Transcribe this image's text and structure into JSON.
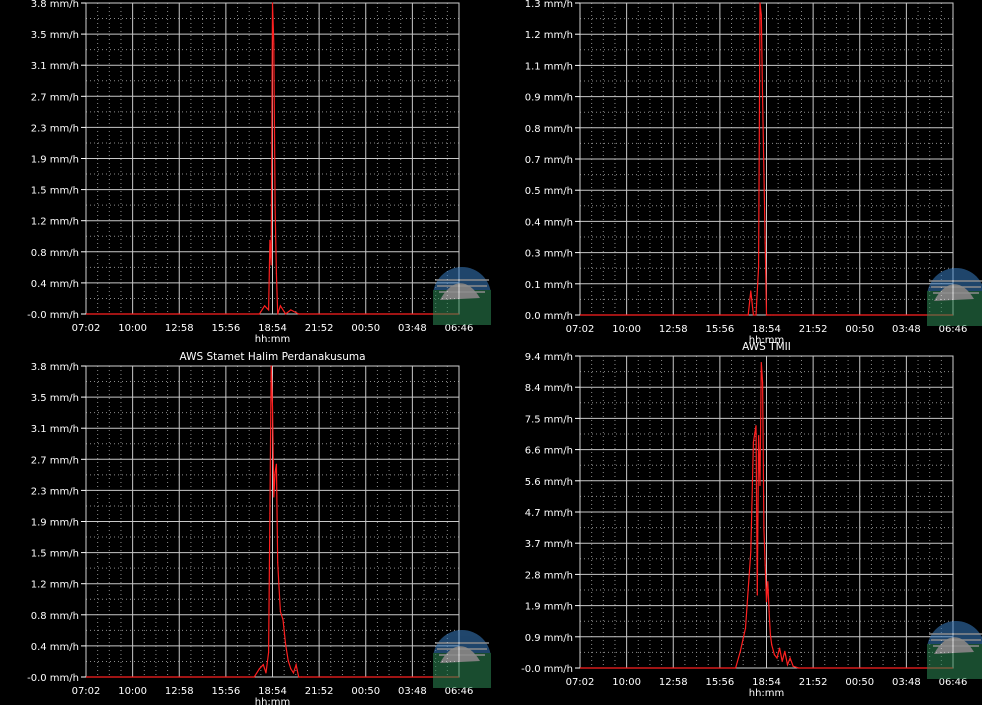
{
  "chart_data": [
    {
      "type": "line",
      "title": "",
      "xlabel": "hh:mm",
      "ylabel": "",
      "ylim": [
        0,
        3.8
      ],
      "grid": true,
      "x_ticks": [
        "07:02",
        "10:00",
        "12:58",
        "15:56",
        "18:54",
        "21:52",
        "00:50",
        "03:48",
        "06:46"
      ],
      "y_ticks": [
        "-0.0 mm/h",
        "0.4 mm/h",
        "0.8 mm/h",
        "1.2 mm/h",
        "1.5 mm/h",
        "1.9 mm/h",
        "2.3 mm/h",
        "2.7 mm/h",
        "3.1 mm/h",
        "3.5 mm/h",
        "3.8 mm/h"
      ],
      "line_color": "#ff2020",
      "series": [
        {
          "x": [
            "18:04",
            "18:24",
            "18:39",
            "18:44",
            "18:49",
            "18:54",
            "18:59",
            "19:04",
            "19:09",
            "19:14",
            "19:24",
            "19:44",
            "20:04",
            "20:34"
          ],
          "values": [
            0,
            0.1,
            0.05,
            0.9,
            0.6,
            3.8,
            3.3,
            1.3,
            0.5,
            0,
            0.1,
            0,
            0.05,
            0
          ]
        }
      ]
    },
    {
      "type": "line",
      "title": "",
      "xlabel": "hh:mm",
      "ylabel": "",
      "ylim": [
        0,
        1.3
      ],
      "grid": true,
      "x_ticks": [
        "07:02",
        "10:00",
        "12:58",
        "15:56",
        "18:54",
        "21:52",
        "00:50",
        "03:48",
        "06:46"
      ],
      "y_ticks": [
        "0.0 mm/h",
        "0.1 mm/h",
        "0.3 mm/h",
        "0.4 mm/h",
        "0.5 mm/h",
        "0.7 mm/h",
        "0.8 mm/h",
        "0.9 mm/h",
        "1.1 mm/h",
        "1.2 mm/h",
        "1.3 mm/h"
      ],
      "line_color": "#ff2020",
      "series": [
        {
          "x": [
            "17:44",
            "17:54",
            "17:59",
            "18:04",
            "18:14",
            "18:24",
            "18:29",
            "18:34",
            "18:39",
            "18:44",
            "18:49",
            "18:54",
            "18:59",
            "19:09",
            "19:19"
          ],
          "values": [
            0,
            0.1,
            0.05,
            0,
            0,
            0.2,
            1.3,
            1.25,
            0.9,
            0.6,
            0.3,
            0,
            0,
            0,
            0
          ]
        }
      ]
    },
    {
      "type": "line",
      "title": "AWS Stamet Halim Perdanakusuma",
      "xlabel": "hh:mm",
      "ylabel": "",
      "ylim": [
        0,
        3.8
      ],
      "grid": true,
      "x_ticks": [
        "07:02",
        "10:00",
        "12:58",
        "15:56",
        "18:54",
        "21:52",
        "00:50",
        "03:48",
        "06:46"
      ],
      "y_ticks": [
        "-0.0 mm/h",
        "0.4 mm/h",
        "0.8 mm/h",
        "1.2 mm/h",
        "1.5 mm/h",
        "1.9 mm/h",
        "2.3 mm/h",
        "2.7 mm/h",
        "3.1 mm/h",
        "3.5 mm/h",
        "3.8 mm/h"
      ],
      "line_color": "#ff2020",
      "series": [
        {
          "x": [
            "17:44",
            "18:04",
            "18:19",
            "18:29",
            "18:39",
            "18:44",
            "18:49",
            "18:54",
            "18:59",
            "19:04",
            "19:09",
            "19:14",
            "19:19",
            "19:24",
            "19:34",
            "19:44",
            "19:54",
            "20:04",
            "20:14",
            "20:24",
            "20:34",
            "20:44"
          ],
          "values": [
            0,
            0.1,
            0.15,
            0.05,
            0.3,
            2.0,
            3.8,
            3.3,
            2.2,
            2.5,
            2.6,
            1.4,
            1.1,
            0.8,
            0.7,
            0.4,
            0.2,
            0.1,
            0.05,
            0.15,
            0,
            0
          ]
        }
      ]
    },
    {
      "type": "line",
      "title": "AWS TMII",
      "xlabel": "hh:mm",
      "ylabel": "",
      "ylim": [
        0,
        9.4
      ],
      "grid": true,
      "x_ticks": [
        "07:02",
        "10:00",
        "12:58",
        "15:56",
        "18:54",
        "21:52",
        "00:50",
        "03:48",
        "06:46"
      ],
      "y_ticks": [
        "-0.0 mm/h",
        "0.9 mm/h",
        "1.9 mm/h",
        "2.8 mm/h",
        "3.7 mm/h",
        "4.7 mm/h",
        "5.6 mm/h",
        "6.6 mm/h",
        "7.5 mm/h",
        "8.4 mm/h",
        "9.4 mm/h"
      ],
      "line_color": "#ff2020",
      "series": [
        {
          "x": [
            "16:56",
            "17:14",
            "17:34",
            "17:54",
            "18:04",
            "18:14",
            "18:19",
            "18:24",
            "18:29",
            "18:34",
            "18:39",
            "18:44",
            "18:49",
            "18:54",
            "18:59",
            "19:04",
            "19:09",
            "19:14",
            "19:24",
            "19:34",
            "19:44",
            "19:54",
            "20:04",
            "20:14",
            "20:24",
            "20:36",
            "20:56"
          ],
          "values": [
            0,
            0.5,
            1.2,
            3.5,
            6.8,
            7.3,
            2.2,
            7.0,
            5.5,
            9.2,
            8.6,
            4.2,
            3.1,
            2.0,
            2.6,
            1.7,
            1.0,
            0.7,
            0.4,
            0.3,
            0.6,
            0.2,
            0.5,
            0.1,
            0.3,
            0.05,
            0
          ]
        }
      ]
    }
  ]
}
